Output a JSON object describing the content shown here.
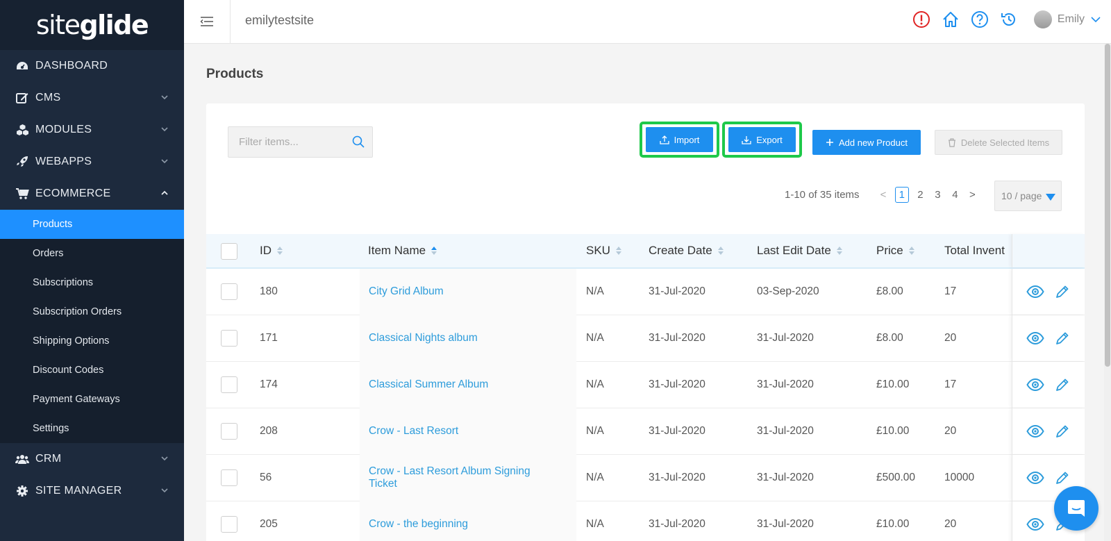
{
  "brand": {
    "logo_light": "site",
    "logo_bold": "glide"
  },
  "sidebar": {
    "items": [
      {
        "label": "DASHBOARD"
      },
      {
        "label": "CMS"
      },
      {
        "label": "MODULES"
      },
      {
        "label": "WEBAPPS"
      },
      {
        "label": "ECOMMERCE"
      },
      {
        "label": "CRM"
      },
      {
        "label": "SITE MANAGER"
      }
    ],
    "ecommerce_sub": [
      {
        "label": "Products"
      },
      {
        "label": "Orders"
      },
      {
        "label": "Subscriptions"
      },
      {
        "label": "Subscription Orders"
      },
      {
        "label": "Shipping Options"
      },
      {
        "label": "Discount Codes"
      },
      {
        "label": "Payment Gateways"
      },
      {
        "label": "Settings"
      }
    ]
  },
  "header": {
    "site_name": "emilytestsite",
    "user_name": "Emily"
  },
  "page": {
    "title": "Products"
  },
  "toolbar": {
    "filter_placeholder": "Filter items...",
    "import_label": "Import",
    "export_label": "Export",
    "add_label": "Add new Product",
    "delete_label": "Delete Selected Items"
  },
  "pagination": {
    "summary": "1-10 of 35 items",
    "prev": "<",
    "next": ">",
    "pages": [
      "1",
      "2",
      "3",
      "4"
    ],
    "current": "1",
    "per_page": "10 / page"
  },
  "table": {
    "columns": [
      "ID",
      "Item Name",
      "SKU",
      "Create Date",
      "Last Edit Date",
      "Price",
      "Total Invent"
    ],
    "rows": [
      {
        "id": "180",
        "name": "City Grid Album",
        "sku": "N/A",
        "created": "31-Jul-2020",
        "edited": "03-Sep-2020",
        "price": "£8.00",
        "inventory": "17"
      },
      {
        "id": "171",
        "name": "Classical Nights album",
        "sku": "N/A",
        "created": "31-Jul-2020",
        "edited": "31-Jul-2020",
        "price": "£8.00",
        "inventory": "20"
      },
      {
        "id": "174",
        "name": "Classical Summer Album",
        "sku": "N/A",
        "created": "31-Jul-2020",
        "edited": "31-Jul-2020",
        "price": "£10.00",
        "inventory": "17"
      },
      {
        "id": "208",
        "name": "Crow - Last Resort",
        "sku": "N/A",
        "created": "31-Jul-2020",
        "edited": "31-Jul-2020",
        "price": "£10.00",
        "inventory": "20"
      },
      {
        "id": "56",
        "name": "Crow - Last Resort Album Signing Ticket",
        "sku": "N/A",
        "created": "31-Jul-2020",
        "edited": "31-Jul-2020",
        "price": "£500.00",
        "inventory": "10000"
      },
      {
        "id": "205",
        "name": "Crow - the beginning",
        "sku": "N/A",
        "created": "31-Jul-2020",
        "edited": "31-Jul-2020",
        "price": "£10.00",
        "inventory": "20"
      }
    ]
  },
  "colors": {
    "accent": "#1e8fef",
    "sidebar": "#1d2a3d",
    "highlight": "#1ec94a",
    "alert": "#e02424"
  },
  "icons": [
    "dashboard-icon",
    "edit-icon",
    "modules-icon",
    "rocket-icon",
    "cart-icon",
    "users-icon",
    "gear-icon",
    "menu-icon",
    "alert-icon",
    "home-icon",
    "help-icon",
    "history-icon",
    "search-icon",
    "upload-icon",
    "download-icon",
    "plus-icon",
    "trash-icon",
    "eye-icon",
    "pencil-icon",
    "chat-icon"
  ]
}
